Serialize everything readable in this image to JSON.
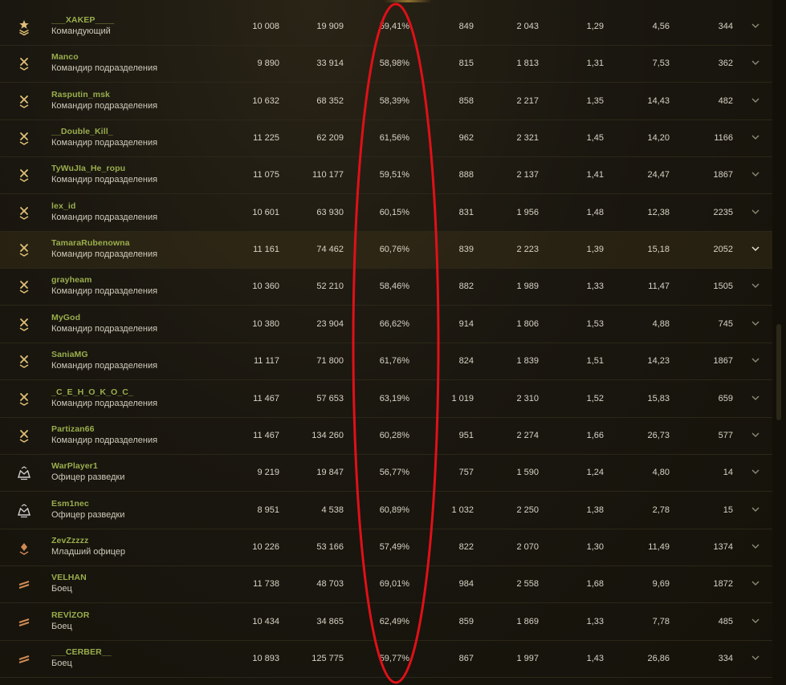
{
  "colors": {
    "name": "#9aae4c",
    "role": "#cfcabb",
    "value": "#d8d3c6",
    "annotation": "#e01018",
    "icon_gold": "#e0c078",
    "icon_silver": "#cfcfcf",
    "icon_bronze": "#d08a55"
  },
  "scroll_position": 0.55,
  "highlighted_row": 6,
  "rows": [
    {
      "name": "___XAKEP____",
      "role": "Командующий",
      "icon": "commander-star-icon",
      "v": [
        "10 008",
        "19 909",
        "59,41%",
        "849",
        "2 043",
        "1,29",
        "4,56",
        "344"
      ]
    },
    {
      "name": "Manco",
      "role": "Командир подразделения",
      "icon": "crossed-swords-chevron-icon",
      "v": [
        "9 890",
        "33 914",
        "58,98%",
        "815",
        "1 813",
        "1,31",
        "7,53",
        "362"
      ]
    },
    {
      "name": "Rasputin_msk",
      "role": "Командир подразделения",
      "icon": "crossed-swords-chevron-icon",
      "v": [
        "10 632",
        "68 352",
        "58,39%",
        "858",
        "2 217",
        "1,35",
        "14,43",
        "482"
      ]
    },
    {
      "name": "__Double_Kill_",
      "role": "Командир подразделения",
      "icon": "crossed-swords-chevron-icon",
      "v": [
        "11 225",
        "62 209",
        "61,56%",
        "962",
        "2 321",
        "1,45",
        "14,20",
        "1166"
      ]
    },
    {
      "name": "TyWuJIa_He_ropu",
      "role": "Командир подразделения",
      "icon": "crossed-swords-chevron-icon",
      "v": [
        "11 075",
        "110 177",
        "59,51%",
        "888",
        "2 137",
        "1,41",
        "24,47",
        "1867"
      ]
    },
    {
      "name": "lex_id",
      "role": "Командир подразделения",
      "icon": "crossed-swords-chevron-icon",
      "v": [
        "10 601",
        "63 930",
        "60,15%",
        "831",
        "1 956",
        "1,48",
        "12,38",
        "2235"
      ]
    },
    {
      "name": "TamaraRubenowna",
      "role": "Командир подразделения",
      "icon": "crossed-swords-chevron-icon",
      "v": [
        "11 161",
        "74 462",
        "60,76%",
        "839",
        "2 223",
        "1,39",
        "15,18",
        "2052"
      ]
    },
    {
      "name": "grayheam",
      "role": "Командир подразделения",
      "icon": "crossed-swords-chevron-icon",
      "v": [
        "10 360",
        "52 210",
        "58,46%",
        "882",
        "1 989",
        "1,33",
        "11,47",
        "1505"
      ]
    },
    {
      "name": "MyGod",
      "role": "Командир подразделения",
      "icon": "crossed-swords-chevron-icon",
      "v": [
        "10 380",
        "23 904",
        "66,62%",
        "914",
        "1 806",
        "1,53",
        "4,88",
        "745"
      ]
    },
    {
      "name": "SaniaMG",
      "role": "Командир подразделения",
      "icon": "crossed-swords-chevron-icon",
      "v": [
        "11 117",
        "71 800",
        "61,76%",
        "824",
        "1 839",
        "1,51",
        "14,23",
        "1867"
      ]
    },
    {
      "name": "_C_E_H_O_K_O_C_",
      "role": "Командир подразделения",
      "icon": "crossed-swords-chevron-icon",
      "v": [
        "11 467",
        "57 653",
        "63,19%",
        "1 019",
        "2 310",
        "1,52",
        "15,83",
        "659"
      ]
    },
    {
      "name": "Partizan66",
      "role": "Командир подразделения",
      "icon": "crossed-swords-chevron-icon",
      "v": [
        "11 467",
        "134 260",
        "60,28%",
        "951",
        "2 274",
        "1,66",
        "26,73",
        "577"
      ]
    },
    {
      "name": "WarPlayer1",
      "role": "Офицер разведки",
      "icon": "recon-officer-emblem-icon",
      "v": [
        "9 219",
        "19 847",
        "56,77%",
        "757",
        "1 590",
        "1,24",
        "4,80",
        "14"
      ]
    },
    {
      "name": "Esm1nec",
      "role": "Офицер разведки",
      "icon": "recon-officer-emblem-icon",
      "v": [
        "8 951",
        "4 538",
        "60,89%",
        "1 032",
        "2 250",
        "1,38",
        "2,78",
        "15"
      ]
    },
    {
      "name": "ZevZzzzz",
      "role": "Младший офицер",
      "icon": "junior-officer-diamond-icon",
      "v": [
        "10 226",
        "53 166",
        "57,49%",
        "822",
        "2 070",
        "1,30",
        "11,49",
        "1374"
      ]
    },
    {
      "name": "VELHAN",
      "role": "Боец",
      "icon": "private-stripes-icon",
      "v": [
        "11 738",
        "48 703",
        "69,01%",
        "984",
        "2 558",
        "1,68",
        "9,69",
        "1872"
      ]
    },
    {
      "name": "REVİZOR",
      "role": "Боец",
      "icon": "private-stripes-icon",
      "v": [
        "10 434",
        "34 865",
        "62,49%",
        "859",
        "1 869",
        "1,33",
        "7,78",
        "485"
      ]
    },
    {
      "name": "___CERBER__",
      "role": "Боец",
      "icon": "private-stripes-icon",
      "v": [
        "10 893",
        "125 775",
        "59,77%",
        "867",
        "1 997",
        "1,43",
        "26,86",
        "334"
      ]
    }
  ]
}
